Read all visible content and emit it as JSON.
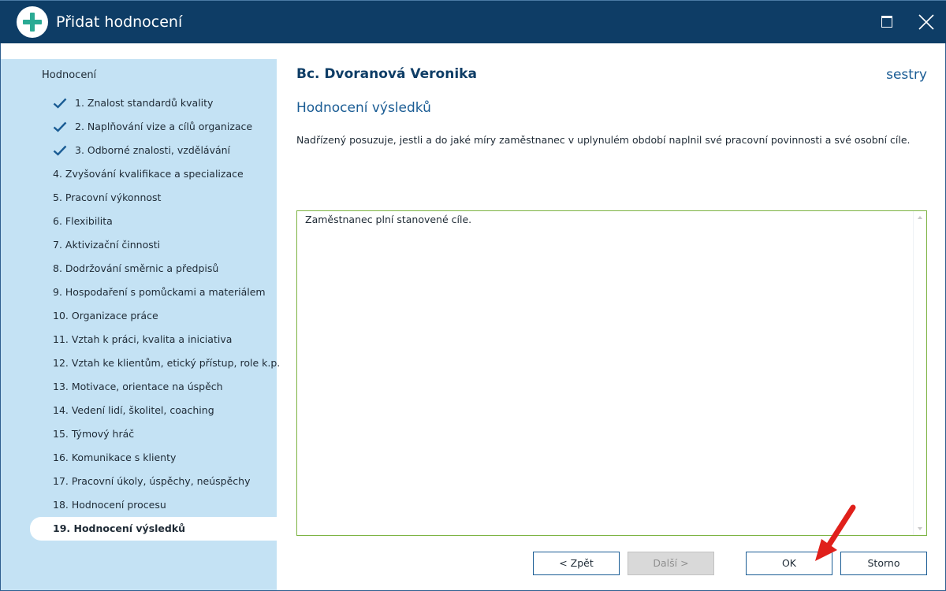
{
  "window": {
    "title": "Přidat hodnocení",
    "icon": "plus-icon",
    "accent": "#0e3d66"
  },
  "sidebar": {
    "header": "Hodnocení",
    "items": [
      {
        "label": "1. Znalost standardů kvality",
        "done": true
      },
      {
        "label": "2. Naplňování vize a cílů organizace",
        "done": true
      },
      {
        "label": "3. Odborné znalosti, vzdělávání",
        "done": true
      },
      {
        "label": "4. Zvyšování kvalifikace a specializace",
        "done": false
      },
      {
        "label": "5. Pracovní výkonnost",
        "done": false
      },
      {
        "label": "6. Flexibilita",
        "done": false
      },
      {
        "label": "7. Aktivizační činnosti",
        "done": false
      },
      {
        "label": "8. Dodržování směrnic a předpisů",
        "done": false
      },
      {
        "label": "9. Hospodaření s pomůckami a materiálem",
        "done": false
      },
      {
        "label": "10. Organizace práce",
        "done": false
      },
      {
        "label": "11. Vztah k práci, kvalita a iniciativa",
        "done": false
      },
      {
        "label": "12. Vztah ke klientům, etický přístup, role k.p.",
        "done": false
      },
      {
        "label": "13. Motivace, orientace na úspěch",
        "done": false
      },
      {
        "label": "14. Vedení lidí, školitel, coaching",
        "done": false
      },
      {
        "label": "15. Týmový hráč",
        "done": false
      },
      {
        "label": "16. Komunikace s klienty",
        "done": false
      },
      {
        "label": "17. Pracovní úkoly, úspěchy, neúspěchy",
        "done": false
      },
      {
        "label": "18. Hodnocení procesu",
        "done": false
      },
      {
        "label": "19. Hodnocení výsledků",
        "done": false,
        "active": true
      }
    ]
  },
  "main": {
    "employee_name": "Bc. Dvoranová Veronika",
    "group": "sestry",
    "section_title": "Hodnocení výsledků",
    "description": "Nadřízený posuzuje, jestli a do jaké míry zaměstnanec v uplynulém období naplnil své pracovní povinnosti a své osobní cíle.",
    "comment_value": "Zaměstnanec plní stanovené cíle."
  },
  "buttons": {
    "back": "< Zpět",
    "next": "Další >",
    "ok": "OK",
    "cancel": "Storno"
  }
}
